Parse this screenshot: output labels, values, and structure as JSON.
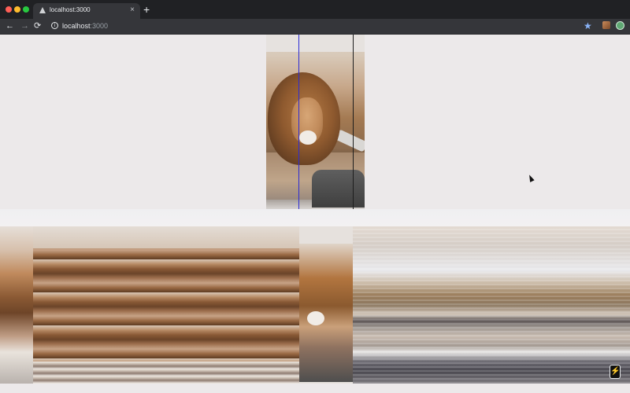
{
  "browser": {
    "tab": {
      "title": "localhost:3000",
      "favicon": "triangle-icon",
      "close_glyph": "×"
    },
    "new_tab_glyph": "+",
    "toolbar": {
      "back_glyph": "←",
      "forward_glyph": "→",
      "reload_glyph": "⟳",
      "info_glyph": "i",
      "url_host": "localhost",
      "url_port": ":3000",
      "bookmark_glyph": "★"
    }
  },
  "page": {
    "badge_glyph": "⚡"
  },
  "colors": {
    "chrome_dark": "#202124",
    "toolbar": "#35363a",
    "page_bg": "#ece9ea",
    "guide_blue": "#2b2bd6",
    "bookmark_star": "#8ab4f8"
  }
}
